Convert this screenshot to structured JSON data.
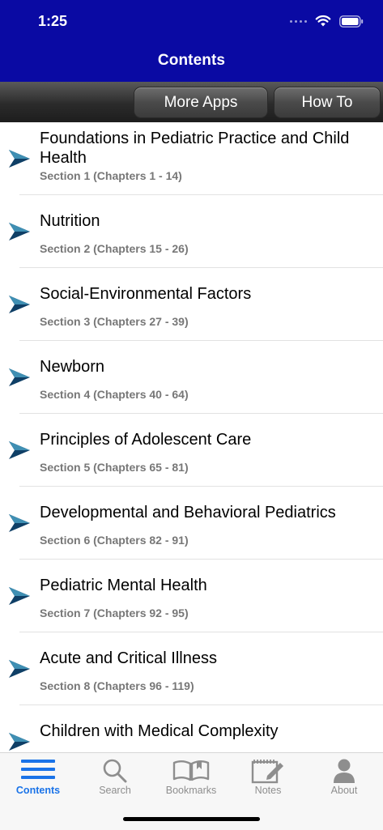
{
  "status": {
    "time": "1:25"
  },
  "nav": {
    "title": "Contents"
  },
  "toolbar": {
    "more_apps_label": "More Apps",
    "how_to_label": "How To"
  },
  "sections": [
    {
      "title": "Foundations in Pediatric Practice and Child Health",
      "subtitle": "Section 1 (Chapters 1 - 14)"
    },
    {
      "title": "Nutrition",
      "subtitle": "Section 2 (Chapters 15 - 26)"
    },
    {
      "title": "Social-Environmental Factors",
      "subtitle": "Section 3 (Chapters 27 - 39)"
    },
    {
      "title": "Newborn",
      "subtitle": "Section 4 (Chapters 40 - 64)"
    },
    {
      "title": "Principles of Adolescent Care",
      "subtitle": "Section 5 (Chapters 65 - 81)"
    },
    {
      "title": "Developmental and Behavioral Pediatrics",
      "subtitle": "Section 6 (Chapters 82 - 91)"
    },
    {
      "title": "Pediatric Mental Health",
      "subtitle": "Section 7 (Chapters 92 - 95)"
    },
    {
      "title": "Acute and Critical Illness",
      "subtitle": "Section 8 (Chapters 96 - 119)"
    },
    {
      "title": "Children with Medical Complexity",
      "subtitle": ""
    }
  ],
  "tabs": [
    {
      "label": "Contents",
      "icon": "list-icon",
      "active": true
    },
    {
      "label": "Search",
      "icon": "magnifier-icon",
      "active": false
    },
    {
      "label": "Bookmarks",
      "icon": "book-icon",
      "active": false
    },
    {
      "label": "Notes",
      "icon": "notepad-icon",
      "active": false
    },
    {
      "label": "About",
      "icon": "person-icon",
      "active": false
    }
  ],
  "colors": {
    "nav_bar": "#0a0aa3",
    "accent": "#1a73e8",
    "arrow": "#0f3f66"
  }
}
